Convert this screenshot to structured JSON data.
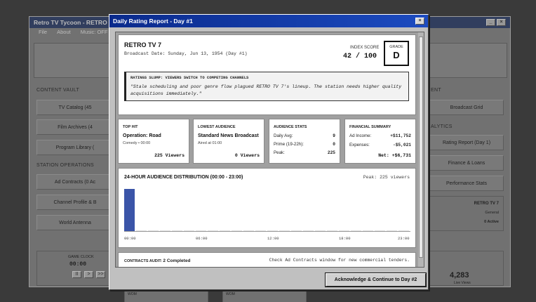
{
  "main": {
    "title": "Retro TV Tycoon - RETRO TV",
    "menu": [
      "File",
      "About",
      "Music: OFF"
    ],
    "content_vault": {
      "heading": "CONTENT VAULT",
      "buttons": [
        "TV Catalog (45",
        "Film Archives (4",
        "Program Library ("
      ]
    },
    "station_ops": {
      "heading": "STATION OPERATIONS",
      "buttons": [
        "Ad Contracts (0 Ac",
        "Channel Profile & B",
        "World Antenna"
      ]
    },
    "right": {
      "heading1": "ENT",
      "btn1": "Broadcast Grid",
      "heading2": "ALYTICS",
      "btns": [
        "Rating Report (Day 1)",
        "Finance & Loans",
        "Performance Stats"
      ],
      "station": "RETRO TV 7",
      "genre": "General",
      "active": "0 Active",
      "big_number": "4,283",
      "big_sub": "Live Views"
    },
    "clock": {
      "label": "GAME CLOCK",
      "time": "00:00",
      "controls": [
        "II",
        ">",
        ">>"
      ]
    },
    "bottom_labels": [
      "WOM",
      "WOM"
    ]
  },
  "modal": {
    "title": "Daily Rating Report - Day #1",
    "close": "×",
    "station": "RETRO TV 7",
    "broadcast_date": "Broadcast Date: Sunday, Jun 13, 1954 (Day #1)",
    "index_label": "INDEX SCORE",
    "index_value": "42 / 100",
    "grade_label": "GRADE",
    "grade_value": "D",
    "slump_heading": "RATINGS SLUMP: VIEWERS SWITCH TO COMPETING CHANNELS",
    "slump_quote": "\"Stale scheduling and poor genre flow plagued RETRO TV 7's lineup. The station needs higher quality acquisitions immediately.\"",
    "top_hit": {
      "heading": "TOP HIT",
      "name": "Operation: Road",
      "sub": "Comedy • 00:00",
      "value": "225 Viewers"
    },
    "lowest": {
      "heading": "LOWEST AUDIENCE",
      "name": "Standard News Broadcast",
      "sub": "Aired at 01:00",
      "value": "0 Viewers"
    },
    "audience": {
      "heading": "AUDIENCE STATS",
      "rows": [
        {
          "k": "Daily Avg:",
          "v": "9"
        },
        {
          "k": "Prime (19-22h):",
          "v": "0"
        },
        {
          "k": "Peak:",
          "v": "225"
        }
      ]
    },
    "financial": {
      "heading": "FINANCIAL SUMMARY",
      "rows": [
        {
          "k": "Ad Income:",
          "v": "+$11,752"
        },
        {
          "k": "Expenses:",
          "v": "-$5,021"
        }
      ],
      "net": "Net: +$6,731"
    },
    "chart_heading": "24-HOUR AUDIENCE DISTRIBUTION (00:00 - 23:00)",
    "peak_text": "Peak: 225 viewers",
    "audit_label": "CONTRACTS AUDIT:",
    "audit_value": "2 Completed",
    "audit_note": "Check Ad Contracts window for new commercial tenders.",
    "ack_button": "Acknowledge & Continue to Day #2",
    "bar_color": "#3b55a8"
  },
  "chart_data": {
    "type": "bar",
    "title": "24-HOUR AUDIENCE DISTRIBUTION (00:00 - 23:00)",
    "categories": [
      "00:00",
      "01:00",
      "02:00",
      "03:00",
      "04:00",
      "05:00",
      "06:00",
      "07:00",
      "08:00",
      "09:00",
      "10:00",
      "11:00",
      "12:00",
      "13:00",
      "14:00",
      "15:00",
      "16:00",
      "17:00",
      "18:00",
      "19:00",
      "20:00",
      "21:00",
      "22:00",
      "23:00"
    ],
    "values": [
      225,
      0,
      0,
      0,
      0,
      0,
      0,
      0,
      0,
      0,
      0,
      0,
      0,
      0,
      0,
      0,
      0,
      0,
      0,
      0,
      0,
      0,
      0,
      0
    ],
    "tick_labels": [
      "00:00",
      "06:00",
      "12:00",
      "18:00",
      "23:00"
    ],
    "ylim": [
      0,
      225
    ]
  }
}
